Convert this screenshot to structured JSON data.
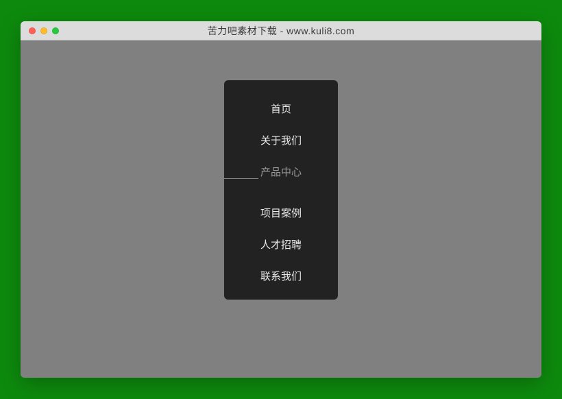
{
  "window": {
    "title": "苦力吧素材下载 - www.kuli8.com"
  },
  "menu": {
    "items": [
      {
        "label": "首页"
      },
      {
        "label": "关于我们"
      },
      {
        "label": "产品中心"
      },
      {
        "label": "项目案例"
      },
      {
        "label": "人才招聘"
      },
      {
        "label": "联系我们"
      }
    ]
  }
}
